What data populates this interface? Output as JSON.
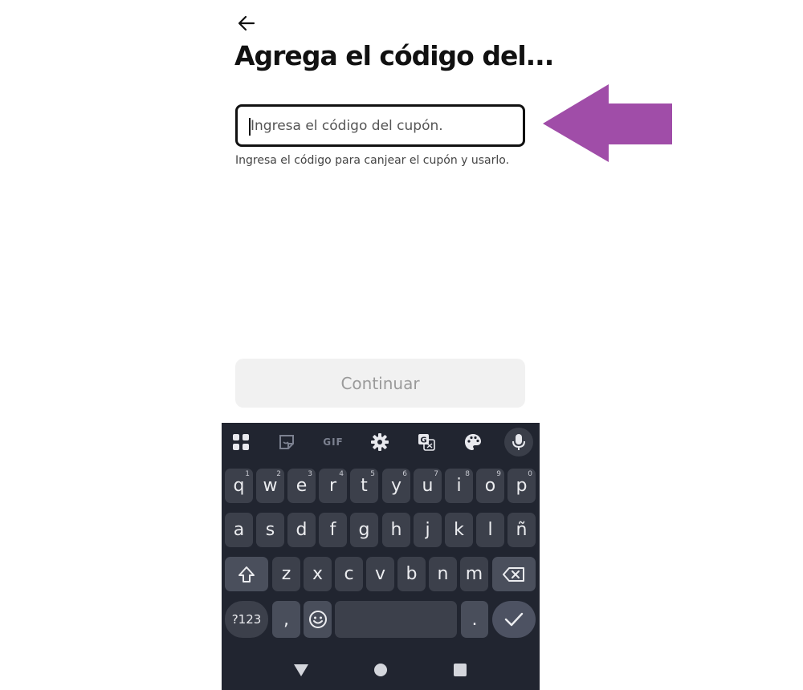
{
  "header": {
    "title": "Agrega el código del...",
    "back_icon": "arrow-left-icon"
  },
  "coupon": {
    "placeholder": "Ingresa el código del cupón.",
    "value": "",
    "helper_text": "Ingresa el código para canjear el cupón y usarlo."
  },
  "annotation": {
    "arrow_icon": "arrow-left-icon",
    "color": "#a04da8"
  },
  "continue_button": {
    "label": "Continuar",
    "enabled": false
  },
  "keyboard": {
    "toolbar": {
      "gif_label": "GIF",
      "icons": [
        "apps-grid-icon",
        "sticker-icon",
        "gif-icon",
        "gear-icon",
        "translate-icon",
        "palette-icon",
        "mic-icon"
      ]
    },
    "row1": [
      {
        "key": "q",
        "hint": "1"
      },
      {
        "key": "w",
        "hint": "2"
      },
      {
        "key": "e",
        "hint": "3"
      },
      {
        "key": "r",
        "hint": "4"
      },
      {
        "key": "t",
        "hint": "5"
      },
      {
        "key": "y",
        "hint": "6"
      },
      {
        "key": "u",
        "hint": "7"
      },
      {
        "key": "i",
        "hint": "8"
      },
      {
        "key": "o",
        "hint": "9"
      },
      {
        "key": "p",
        "hint": "0"
      }
    ],
    "row2": [
      "a",
      "s",
      "d",
      "f",
      "g",
      "h",
      "j",
      "k",
      "l",
      "ñ"
    ],
    "row3": [
      "z",
      "x",
      "c",
      "v",
      "b",
      "n",
      "m"
    ],
    "bottom": {
      "symbols_label": "?123",
      "comma": ",",
      "period": "."
    },
    "colors": {
      "background": "#212530",
      "key": "#3c404b"
    }
  },
  "nav_icons": [
    "back-triangle-icon",
    "home-circle-icon",
    "recents-square-icon"
  ]
}
